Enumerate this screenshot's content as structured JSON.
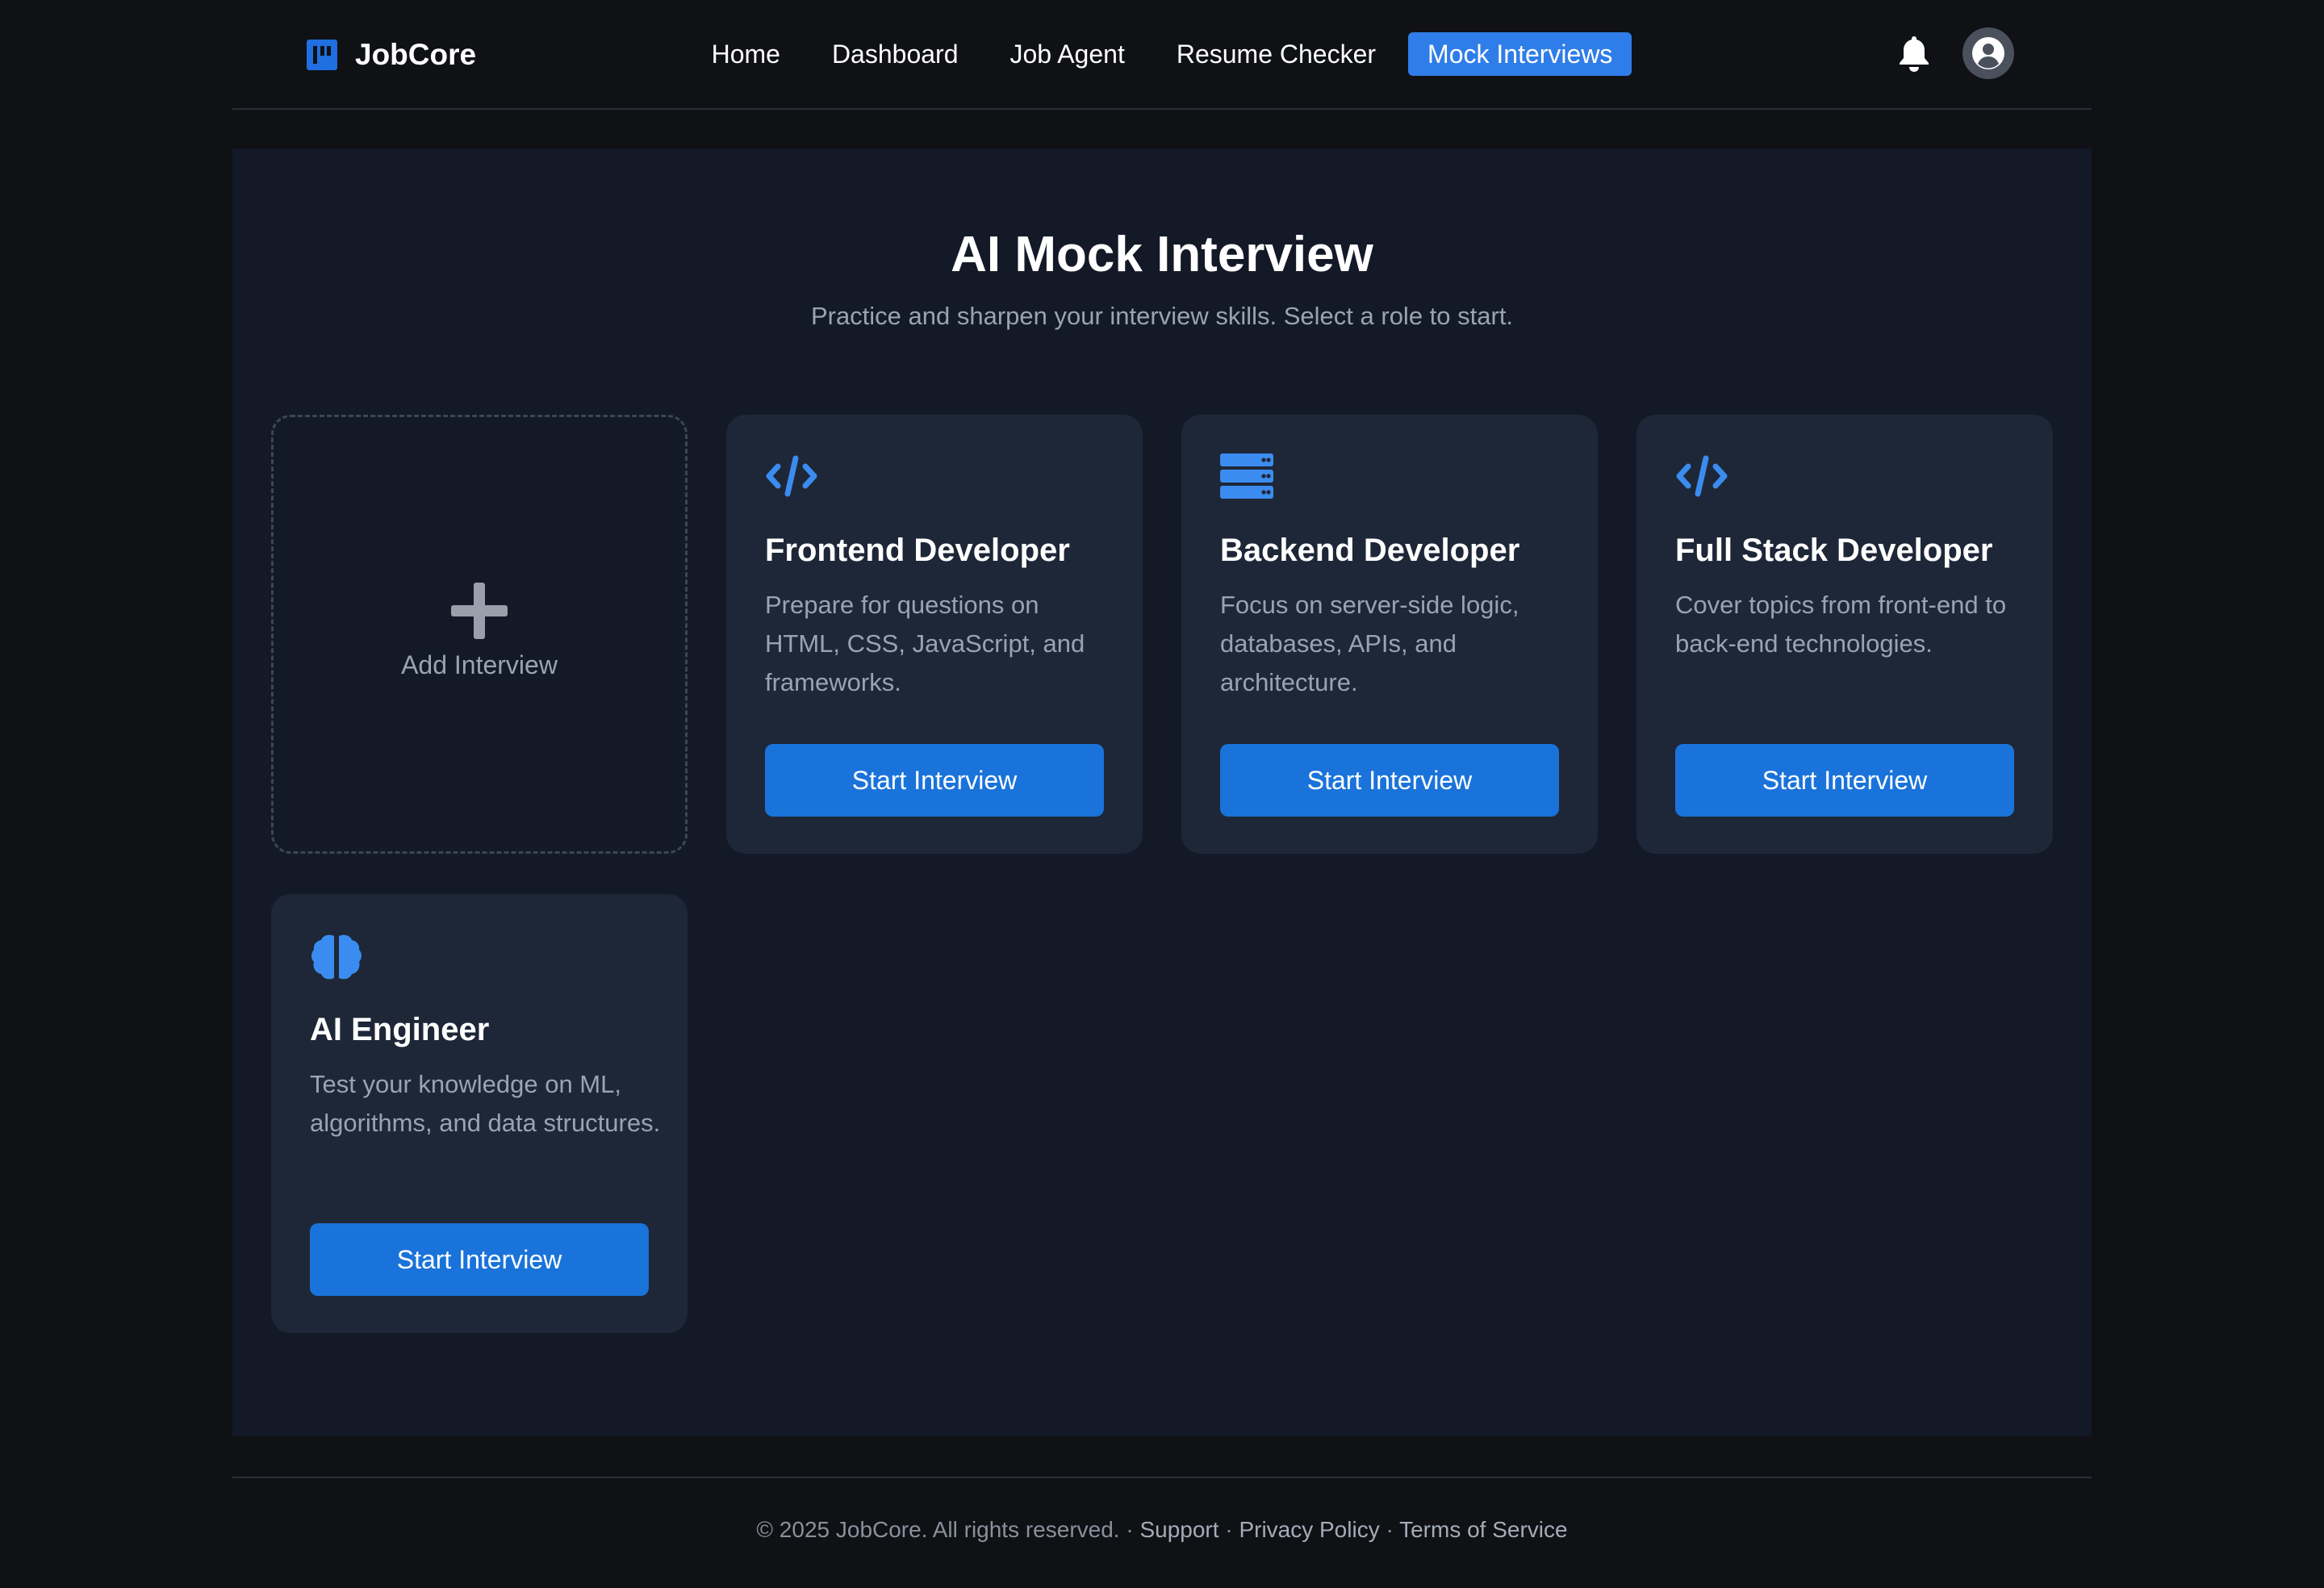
{
  "header": {
    "brand": "JobCore",
    "nav": [
      {
        "label": "Home"
      },
      {
        "label": "Dashboard"
      },
      {
        "label": "Job Agent"
      },
      {
        "label": "Resume Checker"
      },
      {
        "label": "Mock Interviews",
        "active": true
      }
    ],
    "icons": [
      "bell-icon",
      "user-avatar-icon"
    ]
  },
  "main": {
    "title": "AI Mock Interview",
    "subtitle": "Practice and sharpen your interview skills. Select a role to start.",
    "add_card": {
      "label": "Add Interview",
      "icon": "plus-icon"
    },
    "cards": [
      {
        "icon": "code-icon",
        "title": "Frontend Developer",
        "description": "Prepare for questions on HTML, CSS, JavaScript, and frameworks.",
        "button": "Start Interview"
      },
      {
        "icon": "server-icon",
        "title": "Backend Developer",
        "description": "Focus on server-side logic, databases, APIs, and architecture.",
        "button": "Start Interview"
      },
      {
        "icon": "code-icon",
        "title": "Full Stack Developer",
        "description": "Cover topics from front-end to back-end technologies.",
        "button": "Start Interview"
      },
      {
        "icon": "brain-icon",
        "title": "AI Engineer",
        "description": "Test your knowledge on ML, algorithms, and data structures.",
        "button": "Start Interview"
      }
    ]
  },
  "footer": {
    "copyright": "© 2025 JobCore. All rights reserved.",
    "separator": " · ",
    "links": [
      "Support",
      "Privacy Policy",
      "Terms of Service"
    ]
  },
  "colors": {
    "accent": "#1a73da",
    "nav_active": "#2f7de8",
    "icon_blue": "#3b8cf0",
    "background": "#0f1115",
    "panel": "#131927",
    "card": "#1e2737"
  }
}
